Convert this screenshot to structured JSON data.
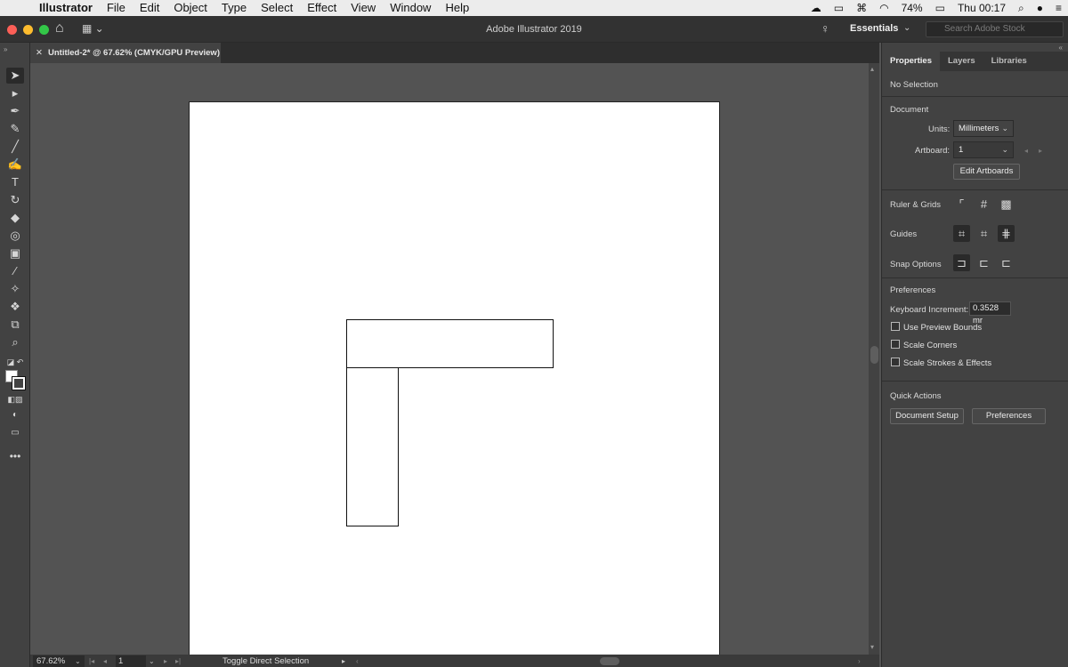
{
  "menubar": {
    "apple": "",
    "items": [
      "Illustrator",
      "File",
      "Edit",
      "Object",
      "Type",
      "Select",
      "Effect",
      "View",
      "Window",
      "Help"
    ],
    "battery": "74%",
    "clock": "Thu 00:17"
  },
  "titlebar": {
    "title": "Adobe Illustrator 2019",
    "workspace": "Essentials",
    "search_placeholder": "Search Adobe Stock"
  },
  "document": {
    "tab_label": "Untitled-2* @ 67.62% (CMYK/GPU Preview)"
  },
  "statusbar": {
    "zoom": "67.62%",
    "artboard_number": "1",
    "status_text": "Toggle Direct Selection"
  },
  "panel": {
    "tabs": [
      "Properties",
      "Layers",
      "Libraries"
    ],
    "selection": "No Selection",
    "document_heading": "Document",
    "units_label": "Units:",
    "units_value": "Millimeters",
    "artboard_label": "Artboard:",
    "artboard_value": "1",
    "edit_artboards": "Edit Artboards",
    "ruler_grids": "Ruler & Grids",
    "guides": "Guides",
    "snap_options": "Snap Options",
    "preferences_heading": "Preferences",
    "keyboard_increment_label": "Keyboard Increment:",
    "keyboard_increment_value": "0.3528 mr",
    "use_preview_bounds": "Use Preview Bounds",
    "scale_corners": "Scale Corners",
    "scale_strokes": "Scale Strokes & Effects",
    "quick_actions": "Quick Actions",
    "document_setup": "Document Setup",
    "preferences_button": "Preferences"
  },
  "icons": {
    "toolbar": [
      "selection-tool-icon",
      "direct-selection-tool-icon",
      "pen-tool-icon",
      "curvature-tool-icon",
      "line-segment-tool-icon",
      "paintbrush-tool-icon",
      "type-tool-icon",
      "rotate-tool-icon",
      "eraser-tool-icon",
      "shape-builder-tool-icon",
      "gradient-tool-icon",
      "eyedropper-tool-icon",
      "width-tool-icon",
      "symbol-sprayer-tool-icon",
      "artboard-tool-icon",
      "zoom-tool-icon"
    ]
  }
}
